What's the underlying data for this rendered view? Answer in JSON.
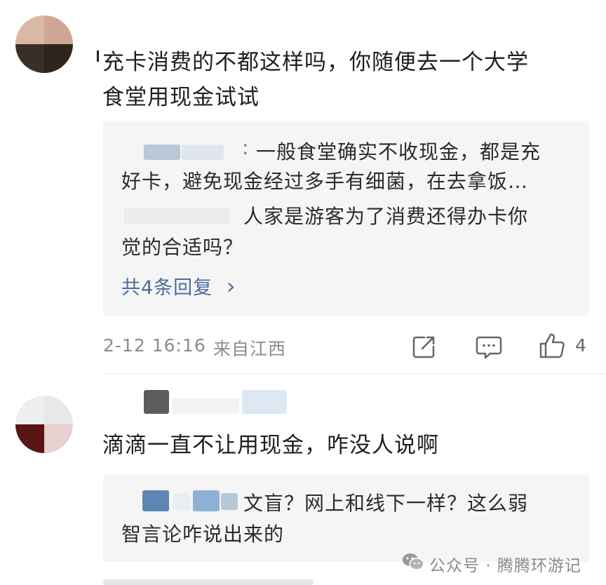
{
  "comment1": {
    "text_line1": "充卡消费的不都这样吗，你随便去一个大学",
    "text_line2": "食堂用现金试试",
    "replies": [
      {
        "line1": "一般食堂确实不收现金，都是充",
        "line2": "好卡，避免现金经过多手有细菌，在去拿饭…"
      },
      {
        "line1": "人家是游客为了消费还得办卡你",
        "line2": "觉的合适吗？"
      }
    ],
    "more_replies": "共4条回复",
    "more_chevron": "›",
    "timestamp": "2-12 16:16",
    "location": "来自江西",
    "like_count": "4",
    "icons": [
      "share-icon",
      "comment-icon",
      "like-icon"
    ]
  },
  "comment2": {
    "text": "滴滴一直不让用现金，咋没人说啊",
    "replies": [
      {
        "line1": "文盲？网上和线下一样？这么弱",
        "line2": "智言论咋说出来的"
      }
    ]
  },
  "watermark": {
    "icon": "wechat-icon",
    "text": "公众号 · 腾腾环游记"
  }
}
